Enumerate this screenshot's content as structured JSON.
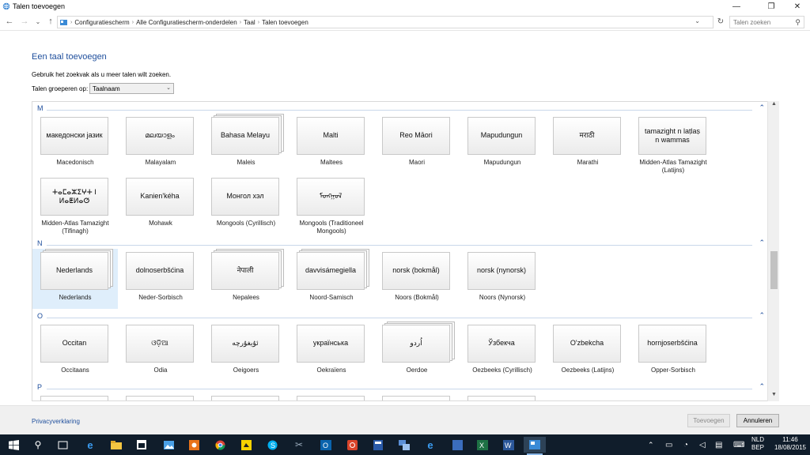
{
  "window": {
    "title": "Talen toevoegen"
  },
  "address": {
    "breadcrumbs": [
      "Configuratiescherm",
      "Alle Configuratiescherm-onderdelen",
      "Taal",
      "Talen toevoegen"
    ],
    "search_placeholder": "Talen zoeken"
  },
  "header": {
    "title": "Een taal toevoegen",
    "description": "Gebruik het zoekvak als u meer talen wilt zoeken.",
    "group_label": "Talen groeperen op:",
    "group_value": "Taalnaam"
  },
  "sections": [
    {
      "letter": "M",
      "tiles": [
        {
          "native": "македонски јазик",
          "name": "Macedonisch"
        },
        {
          "native": "മലയാളം",
          "name": "Malayalam"
        },
        {
          "native": "Bahasa Melayu",
          "name": "Maleis",
          "stack": true
        },
        {
          "native": "Malti",
          "name": "Maltees"
        },
        {
          "native": "Reo Māori",
          "name": "Maori"
        },
        {
          "native": "Mapudungun",
          "name": "Mapudungun"
        },
        {
          "native": "मराठी",
          "name": "Marathi"
        },
        {
          "native": "tamazight n laṭlaṣ n wammas",
          "name": "Midden-Atlas Tamazight (Latijns)"
        },
        {
          "native": "ⵜⴰⵎⴰⵣⵉⵖⵜ ⵏ ⵍⴰⵟⵍⴰⵚ",
          "name": "Midden-Atlas Tamazight (Tifinagh)"
        },
        {
          "native": "Kanien'kéha",
          "name": "Mohawk"
        },
        {
          "native": "Монгол хэл",
          "name": "Mongools (Cyrillisch)"
        },
        {
          "native": "ᠮᠣᠩᠭᠣᠯ",
          "name": "Mongools (Traditioneel Mongools)"
        }
      ]
    },
    {
      "letter": "N",
      "tiles": [
        {
          "native": "Nederlands",
          "name": "Nederlands",
          "stack": true,
          "selected": true
        },
        {
          "native": "dolnoserbšćina",
          "name": "Neder-Sorbisch"
        },
        {
          "native": "नेपाली",
          "name": "Nepalees",
          "stack": true
        },
        {
          "native": "davvisámegiella",
          "name": "Noord-Samisch",
          "stack": true
        },
        {
          "native": "norsk (bokmål)",
          "name": "Noors (Bokmål)"
        },
        {
          "native": "norsk (nynorsk)",
          "name": "Noors (Nynorsk)"
        }
      ]
    },
    {
      "letter": "O",
      "tiles": [
        {
          "native": "Occitan",
          "name": "Occitaans"
        },
        {
          "native": "ଓଡ଼ିଆ",
          "name": "Odia"
        },
        {
          "native": "ئۇيغۇرچە",
          "name": "Oeigoers"
        },
        {
          "native": "українська",
          "name": "Oekraïens"
        },
        {
          "native": "اُردو",
          "name": "Oerdoe",
          "stack": true
        },
        {
          "native": "Ўзбекча",
          "name": "Oezbeeks (Cyrillisch)"
        },
        {
          "native": "O'zbekcha",
          "name": "Oezbeeks (Latijns)"
        },
        {
          "native": "hornjoserbšćina",
          "name": "Opper-Sorbisch"
        }
      ]
    },
    {
      "letter": "P",
      "tiles": []
    }
  ],
  "footer": {
    "privacy": "Privacyverklaring",
    "add_button": "Toevoegen",
    "cancel_button": "Annuleren"
  },
  "taskbar": {
    "language": "NLD",
    "layout": "BEP",
    "time": "11:46",
    "date": "18/08/2015"
  },
  "colors": {
    "accent": "#1e4e9c",
    "taskbar": "#101d2b",
    "selected_tile": "#dfeefb"
  }
}
